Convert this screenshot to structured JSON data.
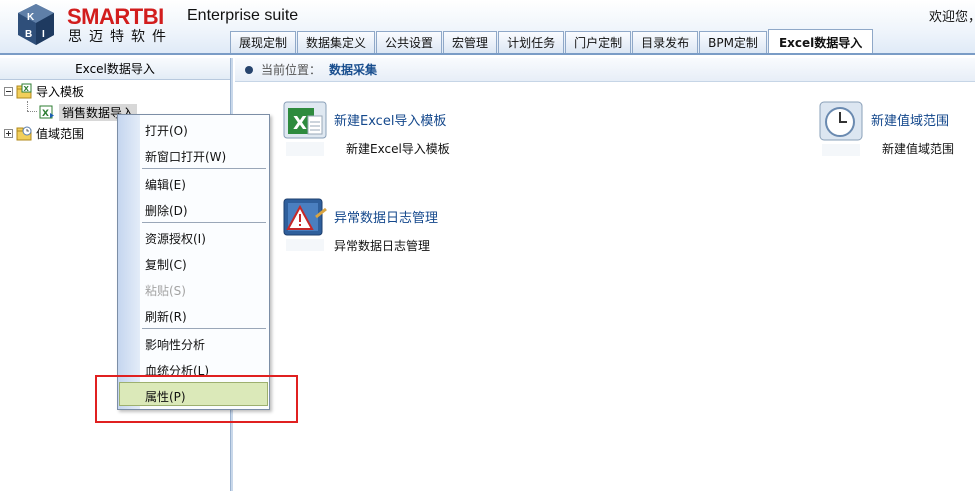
{
  "header": {
    "brand": "SMARTBI",
    "brand_cn": "思迈特软件",
    "suite": "Enterprise suite",
    "welcome": "欢迎您，",
    "logo_letters": [
      "K",
      "B",
      "I"
    ],
    "tabs": [
      {
        "label": "展现定制",
        "active": false
      },
      {
        "label": "数据集定义",
        "active": false
      },
      {
        "label": "公共设置",
        "active": false
      },
      {
        "label": "宏管理",
        "active": false
      },
      {
        "label": "计划任务",
        "active": false
      },
      {
        "label": "门户定制",
        "active": false
      },
      {
        "label": "目录发布",
        "active": false
      },
      {
        "label": "BPM定制",
        "active": false
      },
      {
        "label": "Excel数据导入",
        "active": true
      }
    ]
  },
  "left_panel": {
    "title": "Excel数据导入",
    "tree": {
      "import_templates": "导入模板",
      "sales_import": "销售数据导入",
      "value_range": "值域范围"
    }
  },
  "breadcrumb": {
    "label": "当前位置：",
    "current": "数据采集"
  },
  "items": {
    "new_excel_template": {
      "title": "新建Excel导入模板",
      "desc": "新建Excel导入模板",
      "icon": "excel-template-icon"
    },
    "new_value_range": {
      "title": "新建值域范围",
      "desc": "新建值域范围",
      "icon": "clock-icon"
    },
    "error_log": {
      "title": "异常数据日志管理",
      "desc": "异常数据日志管理",
      "icon": "warning-log-icon"
    }
  },
  "context_menu": {
    "items": [
      {
        "label": "打开(O)",
        "enabled": true
      },
      {
        "label": "新窗口打开(W)",
        "enabled": true
      },
      {
        "label": "编辑(E)",
        "enabled": true
      },
      {
        "label": "删除(D)",
        "enabled": true
      },
      {
        "label": "资源授权(I)",
        "enabled": true
      },
      {
        "label": "复制(C)",
        "enabled": true
      },
      {
        "label": "粘贴(S)",
        "enabled": false
      },
      {
        "label": "刷新(R)",
        "enabled": true
      },
      {
        "label": "影响性分析",
        "enabled": true
      },
      {
        "label": "血统分析(L)",
        "enabled": true
      },
      {
        "label": "属性(P)",
        "enabled": true,
        "highlighted": true
      }
    ]
  },
  "colors": {
    "brand_red": "#d21d1d",
    "link_blue": "#14488c",
    "highlight_red_box": "#e02020",
    "menu_highlight": "#dbe9b9"
  }
}
